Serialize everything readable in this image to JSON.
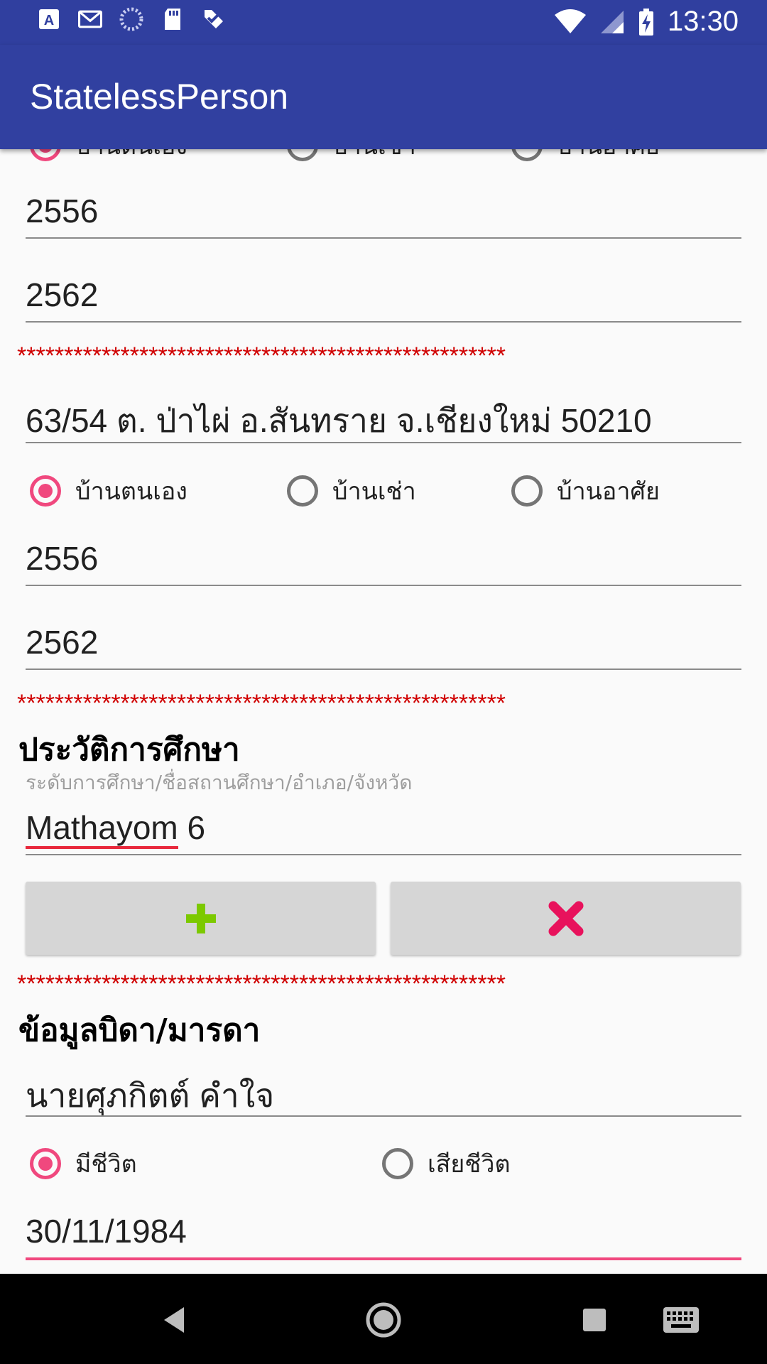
{
  "app": {
    "title": "StatelessPerson"
  },
  "status_bar": {
    "time": "13:30",
    "left_icons": [
      "a-box-icon",
      "gmail-icon",
      "spinner-icon",
      "sd-card-icon",
      "check-tag-icon"
    ],
    "right_icons": [
      "wifi-icon",
      "signal-icon",
      "battery-charging-icon"
    ]
  },
  "address_1": {
    "radios": [
      {
        "label": "บ้านตนเอง",
        "checked": true
      },
      {
        "label": "บ้านเช่า",
        "checked": false
      },
      {
        "label": "บ้านอาศัย",
        "checked": false
      }
    ],
    "year_from": "2556",
    "year_to": "2562"
  },
  "separator": "****************************************************",
  "address_2": {
    "address": "63/54 ต. ป่าไผ่ อ.สันทราย จ.เชียงใหม่ 50210",
    "radios": [
      {
        "label": "บ้านตนเอง",
        "checked": true
      },
      {
        "label": "บ้านเช่า",
        "checked": false
      },
      {
        "label": "บ้านอาศัย",
        "checked": false
      }
    ],
    "year_from": "2556",
    "year_to": "2562"
  },
  "education": {
    "heading": "ประวัติการศึกษา",
    "hint": "ระดับการศึกษา/ชื่อสถานศึกษา/อำเภอ/จังหวัด",
    "value_word": "Mathayom",
    "value_rest": " 6",
    "add_icon": "plus-icon",
    "remove_icon": "close-icon"
  },
  "parents": {
    "heading": "ข้อมูลบิดา/มารดา",
    "name": "นายศุภกิตต์ คำใจ",
    "radios": [
      {
        "label": "มีชีวิต",
        "checked": true
      },
      {
        "label": "เสียชีวิต",
        "checked": false
      }
    ],
    "birth_date": "30/11/1984"
  },
  "colors": {
    "primary": "#3140a0",
    "accent": "#f0487e",
    "separator": "#d00000",
    "add_icon": "#7cc900",
    "remove_icon": "#e8125c"
  }
}
